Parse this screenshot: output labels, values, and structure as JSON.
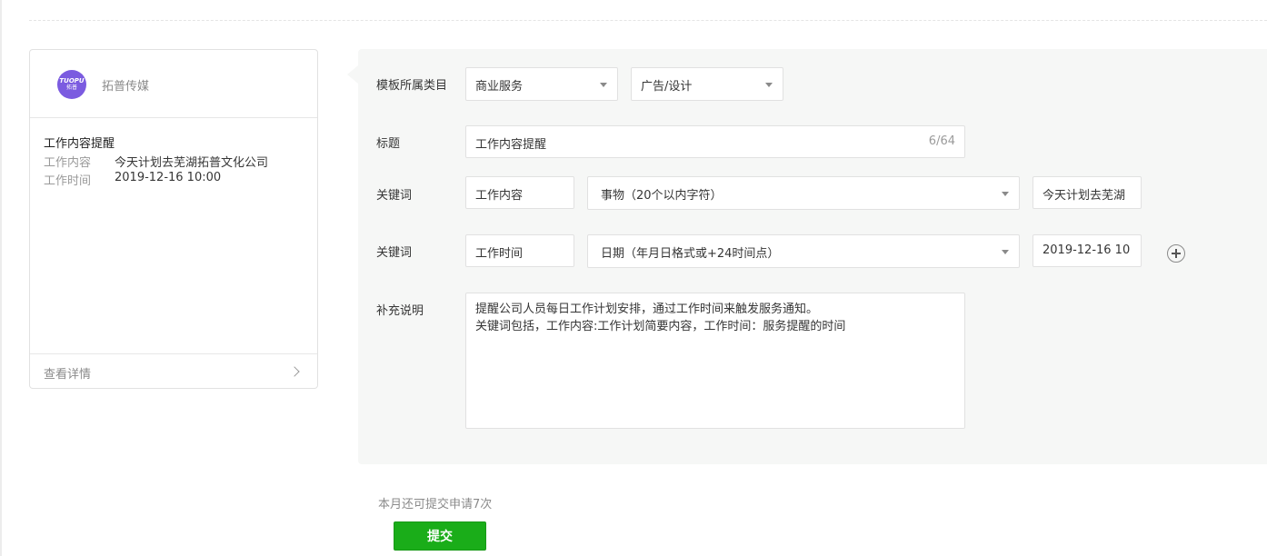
{
  "preview": {
    "account_name": "拓普传媒",
    "avatar": {
      "line1": "TUOPU",
      "line2": "拓普",
      "color": "#7b5be0"
    },
    "title": "工作内容提醒",
    "rows": [
      {
        "key": "工作内容",
        "value": "今天计划去芜湖拓普文化公司"
      },
      {
        "key": "工作时间",
        "value": "2019-12-16 10:00"
      }
    ],
    "detail_link": "查看详情"
  },
  "form": {
    "category": {
      "label": "模板所属类目",
      "primary_selected": "商业服务",
      "secondary_selected": "广告/设计"
    },
    "title": {
      "label": "标题",
      "value": "工作内容提醒",
      "counter": "6/64"
    },
    "keywords": [
      {
        "label": "关键词",
        "name": "工作内容",
        "type": "事物（20个以内字符）",
        "example": "今天计划去芜湖"
      },
      {
        "label": "关键词",
        "name": "工作时间",
        "type": "日期（年月日格式或+24时间点）",
        "example": "2019-12-16 10"
      }
    ],
    "description": {
      "label": "补充说明",
      "lines": [
        "提醒公司人员每日工作计划安排，通过工作时间来触发服务通知。",
        "关键词包括，工作内容:工作计划简要内容，工作时间：服务提醒的时间"
      ]
    }
  },
  "footer": {
    "quota_text": "本月还可提交申请7次",
    "submit_label": "提交"
  },
  "colors": {
    "accent": "#1aad19",
    "panel_bg": "#f6f7f6"
  }
}
